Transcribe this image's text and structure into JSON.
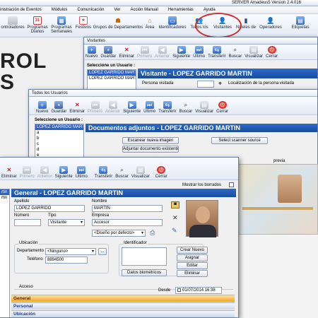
{
  "main_window": {
    "title": "SERVER Amadeus5 Version 2.4.016",
    "menu": [
      "inistración de Eventos",
      "Módulos",
      "Comunicación",
      "Ver",
      "Acción Manual",
      "Herramientas",
      "Ayuda"
    ],
    "toolbar": [
      {
        "label": "ontroladores",
        "icon": "controllers-icon"
      },
      {
        "label": "Programas Diarios",
        "icon": "daily-programs-icon"
      },
      {
        "label": "Programas Semanales",
        "icon": "weekly-programs-icon"
      },
      {
        "label": "Festivos",
        "icon": "holidays-icon"
      },
      {
        "label": "Grupos de Departamentos",
        "icon": "department-groups-icon"
      },
      {
        "label": "Área",
        "icon": "area-icon"
      },
      {
        "label": "Identificadores",
        "icon": "identifiers-icon"
      },
      {
        "label": "Todos los",
        "icon": "all-users-icon"
      },
      {
        "label": "Visitantes",
        "icon": "visitors-icon"
      },
      {
        "label": "Niveles de",
        "icon": "levels-icon"
      },
      {
        "label": "Operadores",
        "icon": "operators-icon"
      },
      {
        "label": "Etiquetas",
        "icon": "labels-icon"
      }
    ],
    "bg_text_1": "ROL",
    "bg_text_2": "S"
  },
  "visitantes_window": {
    "title": "Visitantes",
    "select_user_label": "Seleccione un Usuario :",
    "selected_user": "LOPEZ GARRIDO MARTIN",
    "users": [
      "LOPEZ GARRIDO MARTIN"
    ],
    "header": "Visitante - LOPEZ GARRIDO MARTIN",
    "persona_visitada_label": "Persona visitada",
    "localizacion_label": "Localización de la persona visitada"
  },
  "todos_window": {
    "title": "Todos los Usuarios",
    "select_user_label": "Seleccione un Usuario :",
    "selected_user": "LOPEZ GARRIDO MARTIN",
    "letters": [
      "a",
      "b",
      "c",
      "d",
      "e"
    ],
    "header": "Documentos adjuntos - LOPEZ GARRIDO MARTIN",
    "scan_new_button": "Escanear nueva imagen",
    "attach_button": "Adjuntar documento existente",
    "scanner_button": "Select scanner source",
    "preview_label": "previa"
  },
  "toolbar_buttons": {
    "nuevo": "Nuevo",
    "guardar": "Guardar",
    "eliminar": "Eliminar",
    "primero": "Primero",
    "anterior": "Anterior",
    "siguiente": "Siguiente",
    "ultimo": "Último",
    "transferir": "Transferir",
    "buscar": "Buscar",
    "visualizar": "Visualizar",
    "cerrar": "Cerrar"
  },
  "front_window": {
    "show_deleted_label": "Mostrar los borrados",
    "users": [
      "rtin",
      "rtin"
    ],
    "header": "General - LOPEZ GARRIDO MARTIN",
    "apellido_label": "Apellido",
    "apellido_value": "LOPEZ GARRIDO",
    "nombre_label": "Nombre",
    "nombre_value": "MARTIN",
    "numero_label": "Número",
    "numero_value": "",
    "tipo_label": "Tipo",
    "tipo_value": "Visitante",
    "empresa_label": "Empresa",
    "empresa_value": "Accesor",
    "diseno_value": "<Diseño por defecto>",
    "ubicacion_label": "Ubicación",
    "departamento_label": "Departamento",
    "departamento_value": "<Ninguno>",
    "telefono_label": "Teléfono",
    "telefono_value": "8894500",
    "identificador_label": "Identificador",
    "crear_nuevo": "Crear Nuevo",
    "asignar": "Asignar",
    "editar": "Editar",
    "eliminar_id": "Eliminar",
    "datos_biometricos": "Datos biométricos",
    "acceso_label": "Acceso",
    "desde_label": "Desde",
    "desde_value": "01/07/2014 16:38",
    "sections": [
      "General",
      "Personal",
      "Ubicación"
    ]
  },
  "colors": {
    "header_blue": "#1f5cb8",
    "highlight_circle": "#d0312d",
    "accent_orange": "#f0a020"
  }
}
